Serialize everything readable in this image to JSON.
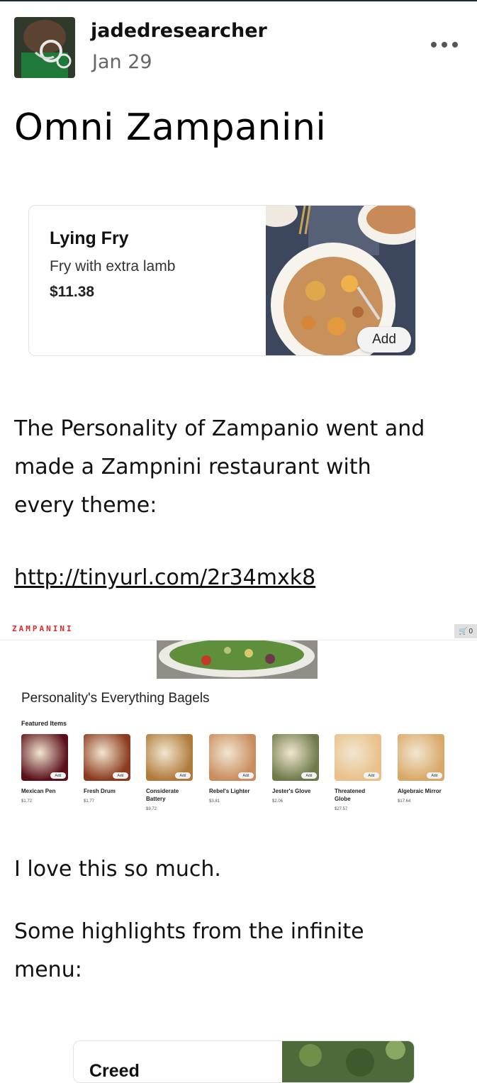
{
  "post": {
    "username": "jadedresearcher",
    "date": "Jan 29",
    "title": "Omni Zampanini"
  },
  "item_card": {
    "name": "Lying Fry",
    "description": "Fry with extra lamb",
    "price": "$11.38",
    "add_label": "Add"
  },
  "body": {
    "para1_lines": [
      "The Personality of Zampanio went and",
      "made a Zampnini restaurant with",
      "every theme:"
    ],
    "link": "http://tinyurl.com/2r34mxk8",
    "para2": "I love this so much.",
    "para3_lines": [
      "Some highlights from the infinite",
      "menu:"
    ]
  },
  "embedded_site": {
    "logo": "ZAMPANINI",
    "cart_count": "0",
    "heading": "Personality's Everything Bagels",
    "featured_label": "Featured Items",
    "add_label": "Add",
    "items": [
      {
        "name_lines": [
          "Mexican Pen"
        ],
        "price": "$1.72",
        "color": "#5a0f1a"
      },
      {
        "name_lines": [
          "Fresh Drum"
        ],
        "price": "$1.77",
        "color": "#8a3a1e"
      },
      {
        "name_lines": [
          "Considerate",
          "Battery"
        ],
        "price": "$9.72",
        "color": "#b07a3a"
      },
      {
        "name_lines": [
          "Rebel's Lighter"
        ],
        "price": "$3.81",
        "color": "#c98c5e"
      },
      {
        "name_lines": [
          "Jester's Glove"
        ],
        "price": "$2.06",
        "color": "#6e7a4a"
      },
      {
        "name_lines": [
          "Threatened",
          "Globe"
        ],
        "price": "$27.57",
        "color": "#e9c08a"
      },
      {
        "name_lines": [
          "Algebraic Mirror"
        ],
        "price": "$17.64",
        "color": "#d9a868"
      }
    ]
  },
  "item_card_2": {
    "name": "Creed"
  },
  "colors": {
    "accent_red": "#d92a2a",
    "muted_text": "#666666"
  }
}
